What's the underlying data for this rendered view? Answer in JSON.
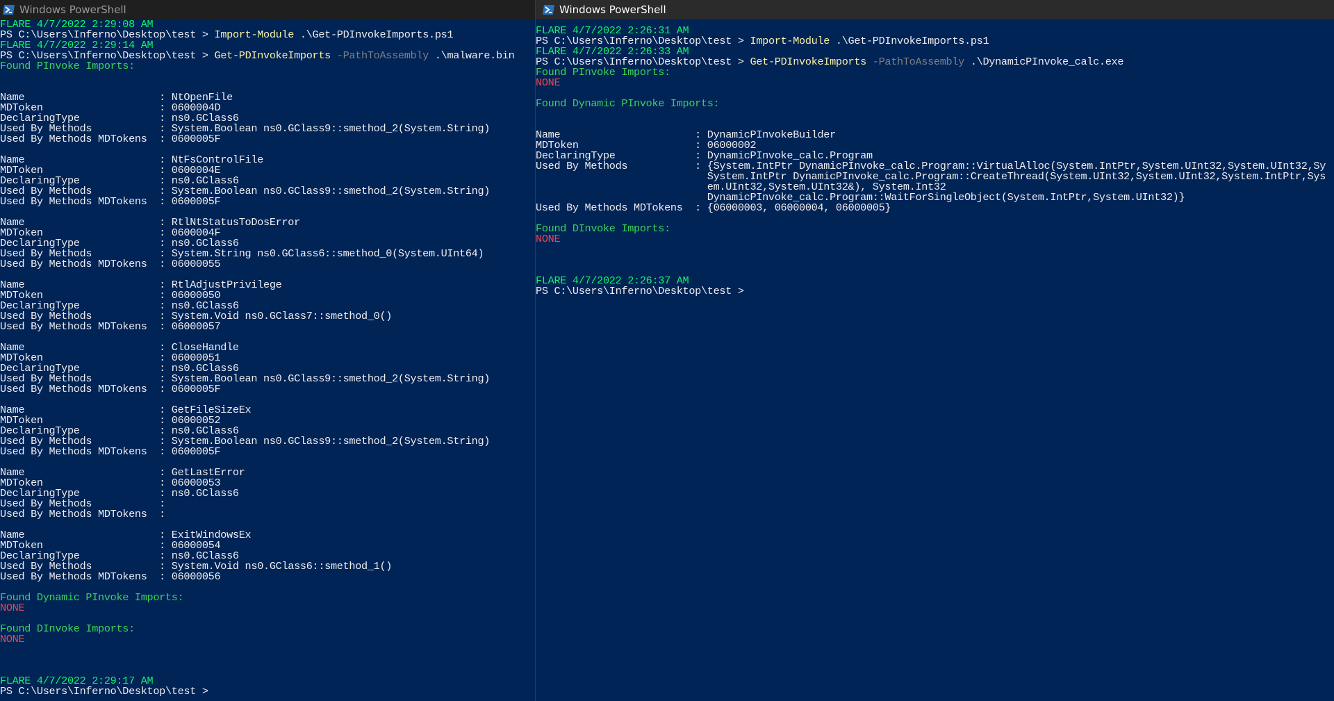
{
  "windows": [
    {
      "title": "Windows PowerShell",
      "lines": [
        [
          {
            "t": "FLARE 4/7/2022 2:29:08 AM",
            "c": "green"
          }
        ],
        [
          {
            "t": "PS C:\\Users\\Inferno\\Desktop\\test > ",
            "c": "white"
          },
          {
            "t": "Import-Module",
            "c": "yellow"
          },
          {
            "t": " .\\Get-PDInvokeImports.ps1",
            "c": "white"
          }
        ],
        [
          {
            "t": "FLARE 4/7/2022 2:29:14 AM",
            "c": "green"
          }
        ],
        [
          {
            "t": "PS C:\\Users\\Inferno\\Desktop\\test > ",
            "c": "white"
          },
          {
            "t": "Get-PDInvokeImports",
            "c": "yellow"
          },
          {
            "t": " -PathToAssembly",
            "c": "gray"
          },
          {
            "t": " .\\malware.bin",
            "c": "white"
          }
        ],
        [
          {
            "t": "Found PInvoke Imports:",
            "c": "greenw"
          }
        ],
        [],
        [],
        [
          {
            "t": "Name                      : NtOpenFile",
            "c": "white"
          }
        ],
        [
          {
            "t": "MDToken                   : 0600004D",
            "c": "white"
          }
        ],
        [
          {
            "t": "DeclaringType             : ns0.GClass6",
            "c": "white"
          }
        ],
        [
          {
            "t": "Used By Methods           : System.Boolean ns0.GClass9::smethod_2(System.String)",
            "c": "white"
          }
        ],
        [
          {
            "t": "Used By Methods MDTokens  : 0600005F",
            "c": "white"
          }
        ],
        [],
        [
          {
            "t": "Name                      : NtFsControlFile",
            "c": "white"
          }
        ],
        [
          {
            "t": "MDToken                   : 0600004E",
            "c": "white"
          }
        ],
        [
          {
            "t": "DeclaringType             : ns0.GClass6",
            "c": "white"
          }
        ],
        [
          {
            "t": "Used By Methods           : System.Boolean ns0.GClass9::smethod_2(System.String)",
            "c": "white"
          }
        ],
        [
          {
            "t": "Used By Methods MDTokens  : 0600005F",
            "c": "white"
          }
        ],
        [],
        [
          {
            "t": "Name                      : RtlNtStatusToDosError",
            "c": "white"
          }
        ],
        [
          {
            "t": "MDToken                   : 0600004F",
            "c": "white"
          }
        ],
        [
          {
            "t": "DeclaringType             : ns0.GClass6",
            "c": "white"
          }
        ],
        [
          {
            "t": "Used By Methods           : System.String ns0.GClass6::smethod_0(System.UInt64)",
            "c": "white"
          }
        ],
        [
          {
            "t": "Used By Methods MDTokens  : 06000055",
            "c": "white"
          }
        ],
        [],
        [
          {
            "t": "Name                      : RtlAdjustPrivilege",
            "c": "white"
          }
        ],
        [
          {
            "t": "MDToken                   : 06000050",
            "c": "white"
          }
        ],
        [
          {
            "t": "DeclaringType             : ns0.GClass6",
            "c": "white"
          }
        ],
        [
          {
            "t": "Used By Methods           : System.Void ns0.GClass7::smethod_0()",
            "c": "white"
          }
        ],
        [
          {
            "t": "Used By Methods MDTokens  : 06000057",
            "c": "white"
          }
        ],
        [],
        [
          {
            "t": "Name                      : CloseHandle",
            "c": "white"
          }
        ],
        [
          {
            "t": "MDToken                   : 06000051",
            "c": "white"
          }
        ],
        [
          {
            "t": "DeclaringType             : ns0.GClass6",
            "c": "white"
          }
        ],
        [
          {
            "t": "Used By Methods           : System.Boolean ns0.GClass9::smethod_2(System.String)",
            "c": "white"
          }
        ],
        [
          {
            "t": "Used By Methods MDTokens  : 0600005F",
            "c": "white"
          }
        ],
        [],
        [
          {
            "t": "Name                      : GetFileSizeEx",
            "c": "white"
          }
        ],
        [
          {
            "t": "MDToken                   : 06000052",
            "c": "white"
          }
        ],
        [
          {
            "t": "DeclaringType             : ns0.GClass6",
            "c": "white"
          }
        ],
        [
          {
            "t": "Used By Methods           : System.Boolean ns0.GClass9::smethod_2(System.String)",
            "c": "white"
          }
        ],
        [
          {
            "t": "Used By Methods MDTokens  : 0600005F",
            "c": "white"
          }
        ],
        [],
        [
          {
            "t": "Name                      : GetLastError",
            "c": "white"
          }
        ],
        [
          {
            "t": "MDToken                   : 06000053",
            "c": "white"
          }
        ],
        [
          {
            "t": "DeclaringType             : ns0.GClass6",
            "c": "white"
          }
        ],
        [
          {
            "t": "Used By Methods           :",
            "c": "white"
          }
        ],
        [
          {
            "t": "Used By Methods MDTokens  :",
            "c": "white"
          }
        ],
        [],
        [
          {
            "t": "Name                      : ExitWindowsEx",
            "c": "white"
          }
        ],
        [
          {
            "t": "MDToken                   : 06000054",
            "c": "white"
          }
        ],
        [
          {
            "t": "DeclaringType             : ns0.GClass6",
            "c": "white"
          }
        ],
        [
          {
            "t": "Used By Methods           : System.Void ns0.GClass6::smethod_1()",
            "c": "white"
          }
        ],
        [
          {
            "t": "Used By Methods MDTokens  : 06000056",
            "c": "white"
          }
        ],
        [],
        [
          {
            "t": "Found Dynamic PInvoke Imports:",
            "c": "greenw"
          }
        ],
        [
          {
            "t": "NONE",
            "c": "red"
          }
        ],
        [],
        [
          {
            "t": "Found DInvoke Imports:",
            "c": "greenw"
          }
        ],
        [
          {
            "t": "NONE",
            "c": "red"
          }
        ],
        [],
        [],
        [],
        [
          {
            "t": "FLARE 4/7/2022 2:29:17 AM",
            "c": "green"
          }
        ],
        [
          {
            "t": "PS C:\\Users\\Inferno\\Desktop\\test >",
            "c": "white"
          }
        ]
      ]
    },
    {
      "title": "Windows PowerShell",
      "lines": [
        [
          {
            "t": "FLARE 4/7/2022 2:26:31 AM",
            "c": "green"
          }
        ],
        [
          {
            "t": "PS C:\\Users\\Inferno\\Desktop\\test > ",
            "c": "white"
          },
          {
            "t": "Import-Module",
            "c": "yellow"
          },
          {
            "t": " .\\Get-PDInvokeImports.ps1",
            "c": "white"
          }
        ],
        [
          {
            "t": "FLARE 4/7/2022 2:26:33 AM",
            "c": "green"
          }
        ],
        [
          {
            "t": "PS C:\\Users\\Inferno\\Desktop\\test > ",
            "c": "white"
          },
          {
            "t": "Get-PDInvokeImports",
            "c": "yellow"
          },
          {
            "t": " -PathToAssembly",
            "c": "gray"
          },
          {
            "t": " .\\DynamicPInvoke_calc.exe",
            "c": "white"
          }
        ],
        [
          {
            "t": "Found PInvoke Imports:",
            "c": "greenw"
          }
        ],
        [
          {
            "t": "NONE",
            "c": "red"
          }
        ],
        [],
        [
          {
            "t": "Found Dynamic PInvoke Imports:",
            "c": "greenw"
          }
        ],
        [],
        [],
        [
          {
            "t": "Name                      : DynamicPInvokeBuilder",
            "c": "white"
          }
        ],
        [
          {
            "t": "MDToken                   : 06000002",
            "c": "white"
          }
        ],
        [
          {
            "t": "DeclaringType             : DynamicPInvoke_calc.Program",
            "c": "white"
          }
        ],
        [
          {
            "t": "Used By Methods           : {System.IntPtr DynamicPInvoke_calc.Program::VirtualAlloc(System.IntPtr,System.UInt32,System.UInt32,Sy",
            "c": "white"
          }
        ],
        [
          {
            "t": "                            System.IntPtr DynamicPInvoke_calc.Program::CreateThread(System.UInt32,System.UInt32,System.IntPtr,Sys",
            "c": "white"
          }
        ],
        [
          {
            "t": "                            em.UInt32,System.UInt32&), System.Int32",
            "c": "white"
          }
        ],
        [
          {
            "t": "                            DynamicPInvoke_calc.Program::WaitForSingleObject(System.IntPtr,System.UInt32)}",
            "c": "white"
          }
        ],
        [
          {
            "t": "Used By Methods MDTokens  : {06000003, 06000004, 06000005}",
            "c": "white"
          }
        ],
        [],
        [
          {
            "t": "Found DInvoke Imports:",
            "c": "greenw"
          }
        ],
        [
          {
            "t": "NONE",
            "c": "red"
          }
        ],
        [],
        [],
        [],
        [
          {
            "t": "FLARE 4/7/2022 2:26:37 AM",
            "c": "green"
          }
        ],
        [
          {
            "t": "PS C:\\Users\\Inferno\\Desktop\\test >",
            "c": "white"
          }
        ]
      ]
    }
  ],
  "icons": {
    "window_icon": "powershell-icon"
  },
  "colors": {
    "background": "#012456",
    "prompt_timestamp": "#13f36c",
    "command": "#f9f1a5",
    "parameter": "#808080",
    "none": "#e74856"
  }
}
